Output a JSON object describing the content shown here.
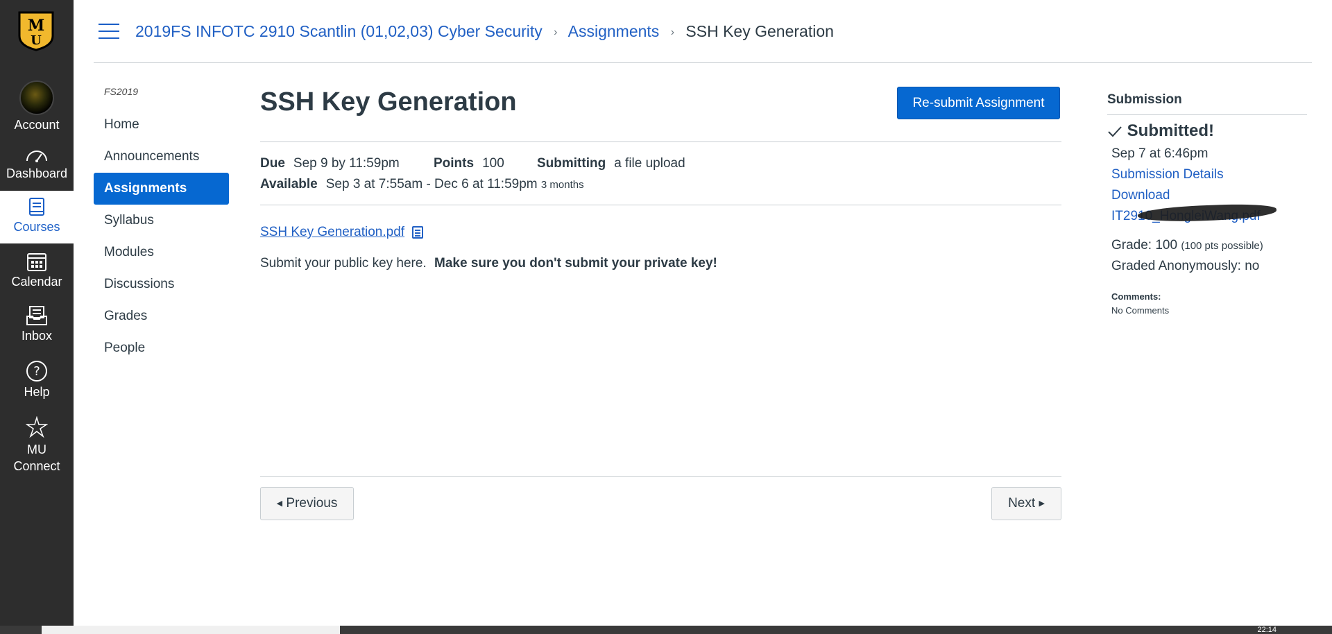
{
  "global_nav": {
    "logo_text": "MU",
    "items": [
      {
        "label": "Account",
        "icon": "avatar"
      },
      {
        "label": "Dashboard",
        "icon": "dashboard-icon"
      },
      {
        "label": "Courses",
        "icon": "courses-icon"
      },
      {
        "label": "Calendar",
        "icon": "calendar-icon"
      },
      {
        "label": "Inbox",
        "icon": "inbox-icon"
      },
      {
        "label": "Help",
        "icon": "help-icon"
      },
      {
        "label": "MU",
        "label2": "Connect",
        "icon": "star-icon"
      }
    ],
    "active_color": "#1a5ec7",
    "bg_color": "#2d2d2d"
  },
  "breadcrumb": {
    "course": "2019FS INFOTC 2910 Scantlin (01,02,03) Cyber Security",
    "section": "Assignments",
    "current": "SSH Key Generation",
    "separator": "›"
  },
  "course_nav": {
    "term": "FS2019",
    "items": [
      "Home",
      "Announcements",
      "Assignments",
      "Syllabus",
      "Modules",
      "Discussions",
      "Grades",
      "People"
    ],
    "active": "Assignments"
  },
  "assignment": {
    "title": "SSH Key Generation",
    "resubmit_label": "Re-submit Assignment",
    "due_label": "Due",
    "due_value": "Sep 9 by 11:59pm",
    "points_label": "Points",
    "points_value": "100",
    "submitting_label": "Submitting",
    "submitting_value": "a file upload",
    "available_label": "Available",
    "available_value": "Sep 3 at 7:55am - Dec 6 at 11:59pm",
    "available_duration": "3 months",
    "file_link": "SSH Key Generation.pdf",
    "description_plain": "Submit your public key here.",
    "description_bold": "Make sure you don't submit your private key!",
    "prev_label": "Previous",
    "next_label": "Next"
  },
  "submission": {
    "heading": "Submission",
    "status": "Submitted!",
    "date": "Sep 7 at 6:46pm",
    "details_link": "Submission Details",
    "download_link": "Download",
    "file_name": "IT2910_HongleiWang.pdf",
    "grade_label": "Grade: 100",
    "grade_possible": "(100 pts possible)",
    "anonymous": "Graded Anonymously: no",
    "comments_label": "Comments:",
    "comments_value": "No Comments"
  },
  "taskbar": {
    "clock": "22:14"
  },
  "colors": {
    "link": "#2160c4",
    "primary_button": "#0668d1",
    "text": "#2d3b45"
  }
}
